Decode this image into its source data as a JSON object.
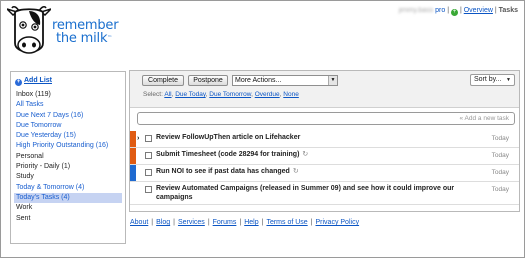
{
  "brand": {
    "line1": "remember",
    "line2": "the milk",
    "tm": "™",
    "color": "#1a6fce"
  },
  "topbar": {
    "username": "jimmy.bass",
    "pro": "pro",
    "sep1": "|",
    "sep2": "|",
    "sep3": "|",
    "overview": "Overview",
    "tasks": "Tasks"
  },
  "sidebar": {
    "add_list": "Add List",
    "lists": [
      {
        "label": "Inbox (119)",
        "kind": "plain"
      },
      {
        "label": "All Tasks",
        "kind": "link"
      },
      {
        "label": "Due Next 7 Days (16)",
        "kind": "link"
      },
      {
        "label": "Due Tomorrow",
        "kind": "link"
      },
      {
        "label": "Due Yesterday (15)",
        "kind": "link"
      },
      {
        "label": "High Priority Outstanding (16)",
        "kind": "link"
      },
      {
        "label": "Personal",
        "kind": "plain"
      },
      {
        "label": "Priority - Daily (1)",
        "kind": "plain"
      },
      {
        "label": "Study",
        "kind": "plain"
      },
      {
        "label": "Today & Tomorrow (4)",
        "kind": "link"
      },
      {
        "label": "Today's Tasks (4)",
        "kind": "sel"
      },
      {
        "label": "Work",
        "kind": "plain"
      },
      {
        "label": "Sent",
        "kind": "plain"
      }
    ]
  },
  "toolbar": {
    "complete": "Complete",
    "postpone": "Postpone",
    "more_actions": "More Actions...",
    "sort_by": "Sort by...",
    "select_label": "Select:",
    "select_all": "All",
    "select_due_today": "Due Today",
    "select_due_tomorrow": "Due Tomorrow",
    "select_overdue": "Overdue",
    "select_none": "None",
    "comma": ","
  },
  "add_task": {
    "placeholder": "« Add a new task"
  },
  "tasks": [
    {
      "title": "Review FollowUpThen article on Lifehacker",
      "due": "Today",
      "priority_color": "#e05b12",
      "repeat": false,
      "pointer": true
    },
    {
      "title": "Submit Timesheet (code 28294 for training)",
      "due": "Today",
      "priority_color": "#e05b12",
      "repeat": true,
      "pointer": false
    },
    {
      "title": "Run NOI to see if past data has changed",
      "due": "Today",
      "priority_color": "#1f6ad0",
      "repeat": true,
      "pointer": false
    },
    {
      "title": "Review Automated Campaigns (released in Summer 09) and see how it could improve our campaigns",
      "due": "Today",
      "priority_color": "#ffffff",
      "repeat": false,
      "pointer": false
    }
  ],
  "footer": {
    "links": [
      "About",
      "Blog",
      "Services",
      "Forums",
      "Help",
      "Terms of Use",
      "Privacy Policy"
    ],
    "sep": "|"
  }
}
